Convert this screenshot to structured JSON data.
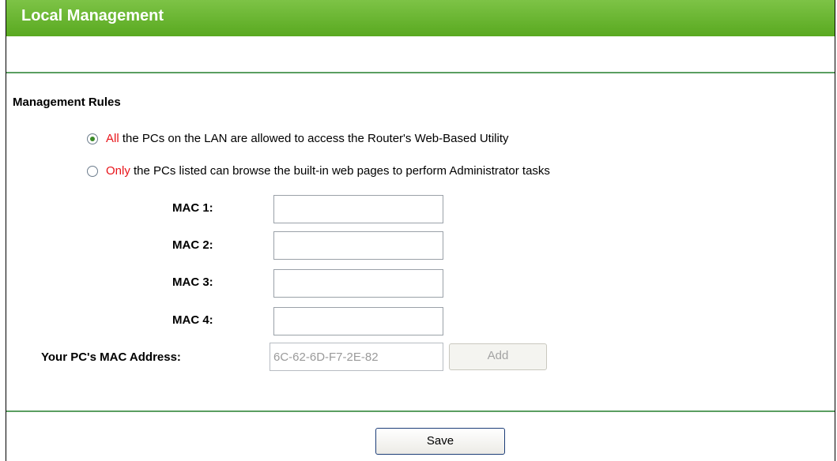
{
  "header": {
    "title": "Local Management"
  },
  "management_rules": {
    "title": "Management Rules",
    "options": [
      {
        "highlight": "All",
        "text": " the PCs on the LAN are allowed to access the Router's Web-Based Utility",
        "selected": true
      },
      {
        "highlight": "Only",
        "text": " the PCs listed can browse the built-in web pages to perform Administrator tasks",
        "selected": false
      }
    ],
    "mac_fields": [
      {
        "label": "MAC 1:",
        "value": ""
      },
      {
        "label": "MAC 2:",
        "value": ""
      },
      {
        "label": "MAC 3:",
        "value": ""
      },
      {
        "label": "MAC 4:",
        "value": ""
      }
    ],
    "your_mac": {
      "label": "Your PC's MAC Address:",
      "value": "6C-62-6D-F7-2E-82"
    },
    "add_label": "Add"
  },
  "footer": {
    "save_label": "Save"
  },
  "colors": {
    "header_green": "#6bb734",
    "divider_green": "#5a9e61",
    "highlight_red": "#e8141a"
  }
}
